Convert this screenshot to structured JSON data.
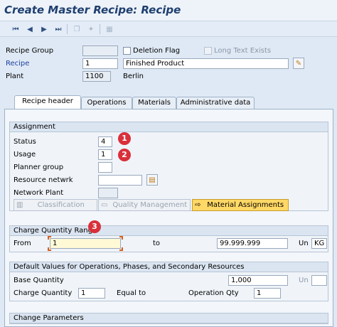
{
  "window": {
    "title": "Create Master Recipe: Recipe"
  },
  "toolbar": {
    "buttons": [
      "first-page-icon",
      "previous-page-icon",
      "next-page-icon",
      "last-page-icon",
      "copy-from-icon",
      "where-used-icon",
      "overview-icon"
    ]
  },
  "header": {
    "recipe_group_label": "Recipe Group",
    "recipe_group_value": "",
    "deletion_flag_label": "Deletion Flag",
    "long_text_label": "Long Text Exists",
    "recipe_label": "Recipe",
    "recipe_value": "1",
    "recipe_description": "Finished Product",
    "plant_label": "Plant",
    "plant_value": "1100",
    "plant_name": "Berlin"
  },
  "tabs": [
    {
      "label": "Recipe header",
      "active": true
    },
    {
      "label": "Operations",
      "active": false
    },
    {
      "label": "Materials",
      "active": false
    },
    {
      "label": "Administrative data",
      "active": false
    }
  ],
  "assignment": {
    "title": "Assignment",
    "status_label": "Status",
    "status_value": "4",
    "usage_label": "Usage",
    "usage_value": "1",
    "planner_group_label": "Planner group",
    "planner_group_value": "",
    "resource_network_label": "Resource netwrk",
    "resource_network_value": "",
    "network_plant_label": "Network Plant",
    "network_plant_value": "",
    "classification_button": "Classification",
    "quality_management_button": "Quality Management",
    "material_assignments_button": "Material Assignments"
  },
  "charge_quantity_range": {
    "title": "Charge Quantity Range",
    "from_label": "From",
    "from_value": "1",
    "to_label": "to",
    "to_value": "99.999.999",
    "unit_label": "Un",
    "unit_value": "KG"
  },
  "default_values": {
    "title": "Default Values for Operations, Phases, and Secondary Resources",
    "base_quantity_label": "Base Quantity",
    "base_quantity_value": "1,000",
    "unit_label": "Un",
    "unit_value": "",
    "charge_quantity_label": "Charge Quantity",
    "charge_quantity_value": "1",
    "equal_to_label": "Equal to",
    "operation_qty_label": "Operation Qty",
    "operation_qty_value": "1"
  },
  "change_parameters": {
    "title": "Change Parameters"
  },
  "badges": [
    "1",
    "2",
    "3"
  ],
  "colors": {
    "badge": "#d9303a",
    "active_button": "#ffd866",
    "title_text": "#1e3f6f"
  }
}
